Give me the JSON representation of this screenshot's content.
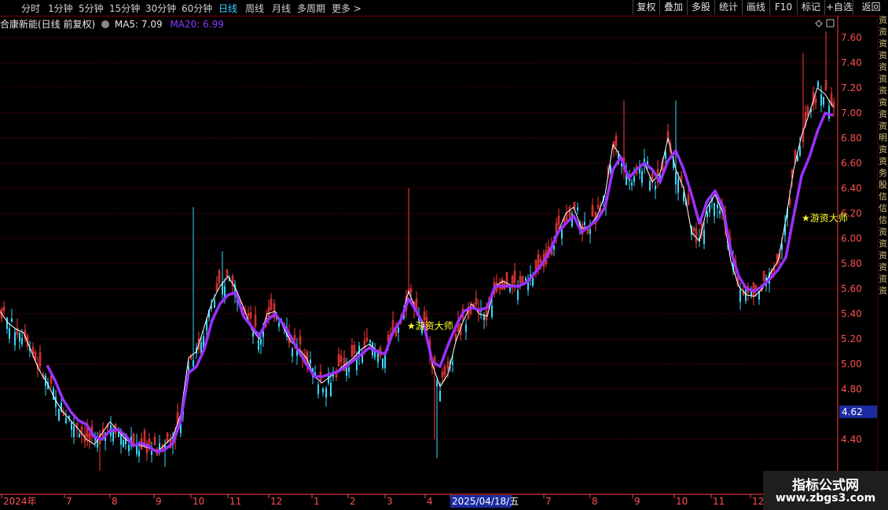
{
  "toolbar": {
    "timeframes": [
      "分时",
      "1分钟",
      "5分钟",
      "15分钟",
      "30分钟",
      "60分钟",
      "日线",
      "周线",
      "月线",
      "多周期",
      "更多 >"
    ],
    "active_timeframe": "日线",
    "right_buttons": [
      "复权",
      "叠加",
      "多股",
      "统计",
      "画线",
      "F10",
      "标记",
      "+自选",
      "返回"
    ]
  },
  "info": {
    "title": "合康新能(日线 前复权)",
    "ma5_label": "MA5: 7.09",
    "ma20_label": "MA20: 6.99"
  },
  "right_sidebar_text": "资资资资资资资资资资明资资务股信信信资资资资资资",
  "watermark": {
    "line1": "指标公式网",
    "line2": "www.zbgs3.com"
  },
  "colors": {
    "up": "#ff3b3b",
    "down": "#38d8ff",
    "ma5": "#ffffff",
    "ma20": "#9b30ff",
    "grid": "#6a0000",
    "axis": "#ff4040",
    "signal": "#ffff30"
  },
  "chart_data": {
    "type": "line",
    "title": "合康新能(日线 前复权)",
    "ylim": [
      4.1,
      7.75
    ],
    "yticks": [
      7.6,
      7.4,
      7.2,
      7.0,
      6.8,
      6.6,
      6.4,
      6.2,
      6.0,
      5.8,
      5.6,
      5.4,
      5.2,
      5.0,
      4.8,
      4.6,
      4.4
    ],
    "current_price": 4.62,
    "x_tick_labels": [
      "2024年",
      "7",
      "8",
      "9",
      "10",
      "11",
      "12",
      "1",
      "2",
      "3",
      "4",
      "2025/04/18/五",
      "7",
      "8",
      "9",
      "10",
      "11",
      "12"
    ],
    "series": [
      {
        "name": "MA5",
        "x": [
          0,
          10,
          20,
          30,
          40,
          50,
          60,
          70,
          80,
          90,
          100,
          110,
          120,
          130,
          140,
          150,
          160,
          170,
          180,
          190,
          200,
          210,
          220,
          230,
          240,
          250,
          260,
          270,
          280,
          290,
          300,
          310,
          320,
          330,
          340,
          350,
          360,
          370,
          380,
          390,
          400,
          410,
          420,
          430,
          440,
          450,
          460,
          470,
          480,
          490,
          500,
          510,
          520,
          530,
          540,
          550,
          560,
          570,
          580,
          590,
          600,
          610,
          620,
          630,
          640,
          650,
          660,
          670,
          680,
          690,
          700,
          710,
          720,
          730,
          740,
          750,
          760,
          770,
          780,
          790,
          800,
          810,
          820,
          830,
          840,
          850,
          860,
          870,
          880,
          890,
          900,
          910,
          920,
          930,
          940,
          950,
          960,
          970,
          980,
          990,
          1000,
          1010,
          1020,
          1030,
          1040,
          1050,
          1060
        ],
        "values": [
          5.42,
          5.33,
          5.28,
          5.25,
          5.1,
          4.95,
          4.85,
          4.72,
          4.62,
          4.55,
          4.48,
          4.4,
          4.36,
          4.45,
          4.54,
          4.47,
          4.4,
          4.36,
          4.35,
          4.33,
          4.3,
          4.36,
          4.42,
          4.6,
          5.05,
          5.1,
          5.3,
          5.5,
          5.62,
          5.7,
          5.6,
          5.45,
          5.28,
          5.2,
          5.4,
          5.42,
          5.3,
          5.18,
          5.12,
          5.05,
          4.9,
          4.85,
          4.9,
          4.95,
          5.0,
          5.05,
          5.12,
          5.16,
          5.1,
          5.08,
          5.25,
          5.35,
          5.58,
          5.42,
          5.3,
          5.0,
          4.82,
          4.92,
          5.18,
          5.35,
          5.48,
          5.4,
          5.38,
          5.62,
          5.66,
          5.63,
          5.62,
          5.65,
          5.72,
          5.8,
          5.92,
          6.05,
          6.2,
          6.25,
          6.08,
          6.1,
          6.18,
          6.35,
          6.75,
          6.65,
          6.48,
          6.55,
          6.6,
          6.45,
          6.52,
          6.8,
          6.55,
          6.4,
          6.05,
          5.98,
          6.25,
          6.35,
          6.2,
          5.82,
          5.62,
          5.55,
          5.54,
          5.6,
          5.72,
          5.82,
          6.15,
          6.55,
          6.82,
          7.0,
          7.2,
          7.15,
          7.05
        ]
      },
      {
        "name": "MA20",
        "x": [
          60,
          70,
          80,
          90,
          100,
          110,
          120,
          130,
          140,
          150,
          160,
          170,
          180,
          190,
          200,
          210,
          220,
          230,
          240,
          250,
          260,
          270,
          280,
          290,
          300,
          310,
          320,
          330,
          340,
          350,
          360,
          370,
          380,
          390,
          400,
          410,
          420,
          430,
          440,
          450,
          460,
          470,
          480,
          490,
          500,
          510,
          520,
          530,
          540,
          550,
          560,
          570,
          580,
          590,
          600,
          610,
          620,
          630,
          640,
          650,
          660,
          670,
          680,
          690,
          700,
          710,
          720,
          730,
          740,
          750,
          760,
          770,
          780,
          790,
          800,
          810,
          820,
          830,
          840,
          850,
          860,
          870,
          880,
          890,
          900,
          910,
          920,
          930,
          940,
          950,
          960,
          970,
          980,
          990,
          1000,
          1010,
          1020,
          1030,
          1040,
          1050,
          1060
        ],
        "values": [
          4.99,
          4.87,
          4.72,
          4.62,
          4.55,
          4.52,
          4.42,
          4.4,
          4.47,
          4.48,
          4.43,
          4.35,
          4.37,
          4.34,
          4.3,
          4.32,
          4.37,
          4.55,
          4.93,
          4.98,
          5.12,
          5.35,
          5.48,
          5.55,
          5.57,
          5.38,
          5.3,
          5.22,
          5.35,
          5.4,
          5.32,
          5.22,
          5.1,
          5.0,
          4.9,
          4.9,
          4.92,
          4.94,
          4.98,
          5.03,
          5.08,
          5.13,
          5.1,
          5.08,
          5.25,
          5.35,
          5.52,
          5.42,
          5.3,
          5.02,
          4.98,
          5.15,
          5.3,
          5.42,
          5.45,
          5.43,
          5.45,
          5.62,
          5.62,
          5.62,
          5.62,
          5.65,
          5.72,
          5.8,
          5.9,
          6.05,
          6.12,
          6.18,
          6.05,
          6.1,
          6.15,
          6.25,
          6.55,
          6.65,
          6.48,
          6.55,
          6.6,
          6.55,
          6.45,
          6.62,
          6.7,
          6.55,
          6.35,
          6.12,
          6.3,
          6.38,
          6.25,
          5.9,
          5.7,
          5.6,
          5.58,
          5.62,
          5.68,
          5.75,
          5.85,
          6.18,
          6.5,
          6.65,
          6.85,
          7.0,
          6.98
        ]
      }
    ],
    "signals": [
      {
        "label": "★游资大师",
        "x": 518,
        "y": 5.31
      },
      {
        "label": "★游资大师",
        "x": 1020,
        "y": 6.17
      }
    ]
  }
}
